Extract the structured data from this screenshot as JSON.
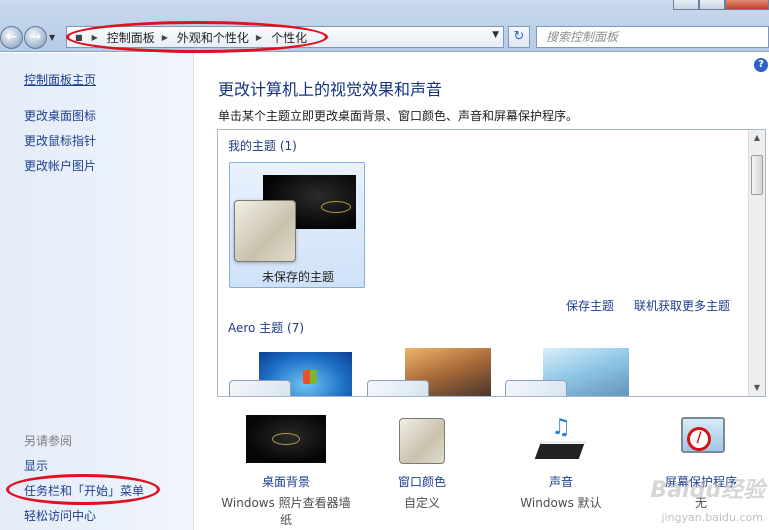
{
  "address_bar": {
    "crumbs": [
      "控制面板",
      "外观和个性化",
      "个性化"
    ],
    "search_placeholder": "搜索控制面板"
  },
  "left_pane": {
    "home": "控制面板主页",
    "links": [
      "更改桌面图标",
      "更改鼠标指针",
      "更改帐户图片"
    ],
    "see_also_title": "另请参阅",
    "see_also_links": [
      "显示",
      "任务栏和「开始」菜单",
      "轻松访问中心"
    ]
  },
  "main": {
    "heading": "更改计算机上的视觉效果和声音",
    "description": "单击某个主题立即更改桌面背景、窗口颜色、声音和屏幕保护程序。",
    "my_themes_label": "我的主题 (1)",
    "unsaved_theme_label": "未保存的主题",
    "save_theme_link": "保存主题",
    "get_more_link": "联机获取更多主题",
    "aero_label": "Aero 主题 (7)"
  },
  "bottom_items": [
    {
      "label": "桌面背景",
      "sub": "Windows 照片查看器墙纸"
    },
    {
      "label": "窗口颜色",
      "sub": "自定义"
    },
    {
      "label": "声音",
      "sub": "Windows 默认"
    },
    {
      "label": "屏幕保护程序",
      "sub": "无"
    }
  ],
  "watermark": {
    "brand": "Baidu经验",
    "url": "jingyan.baidu.com"
  },
  "colors": {
    "link": "#1c3f8f",
    "heading": "#15337f",
    "annotation": "#e0101f"
  }
}
